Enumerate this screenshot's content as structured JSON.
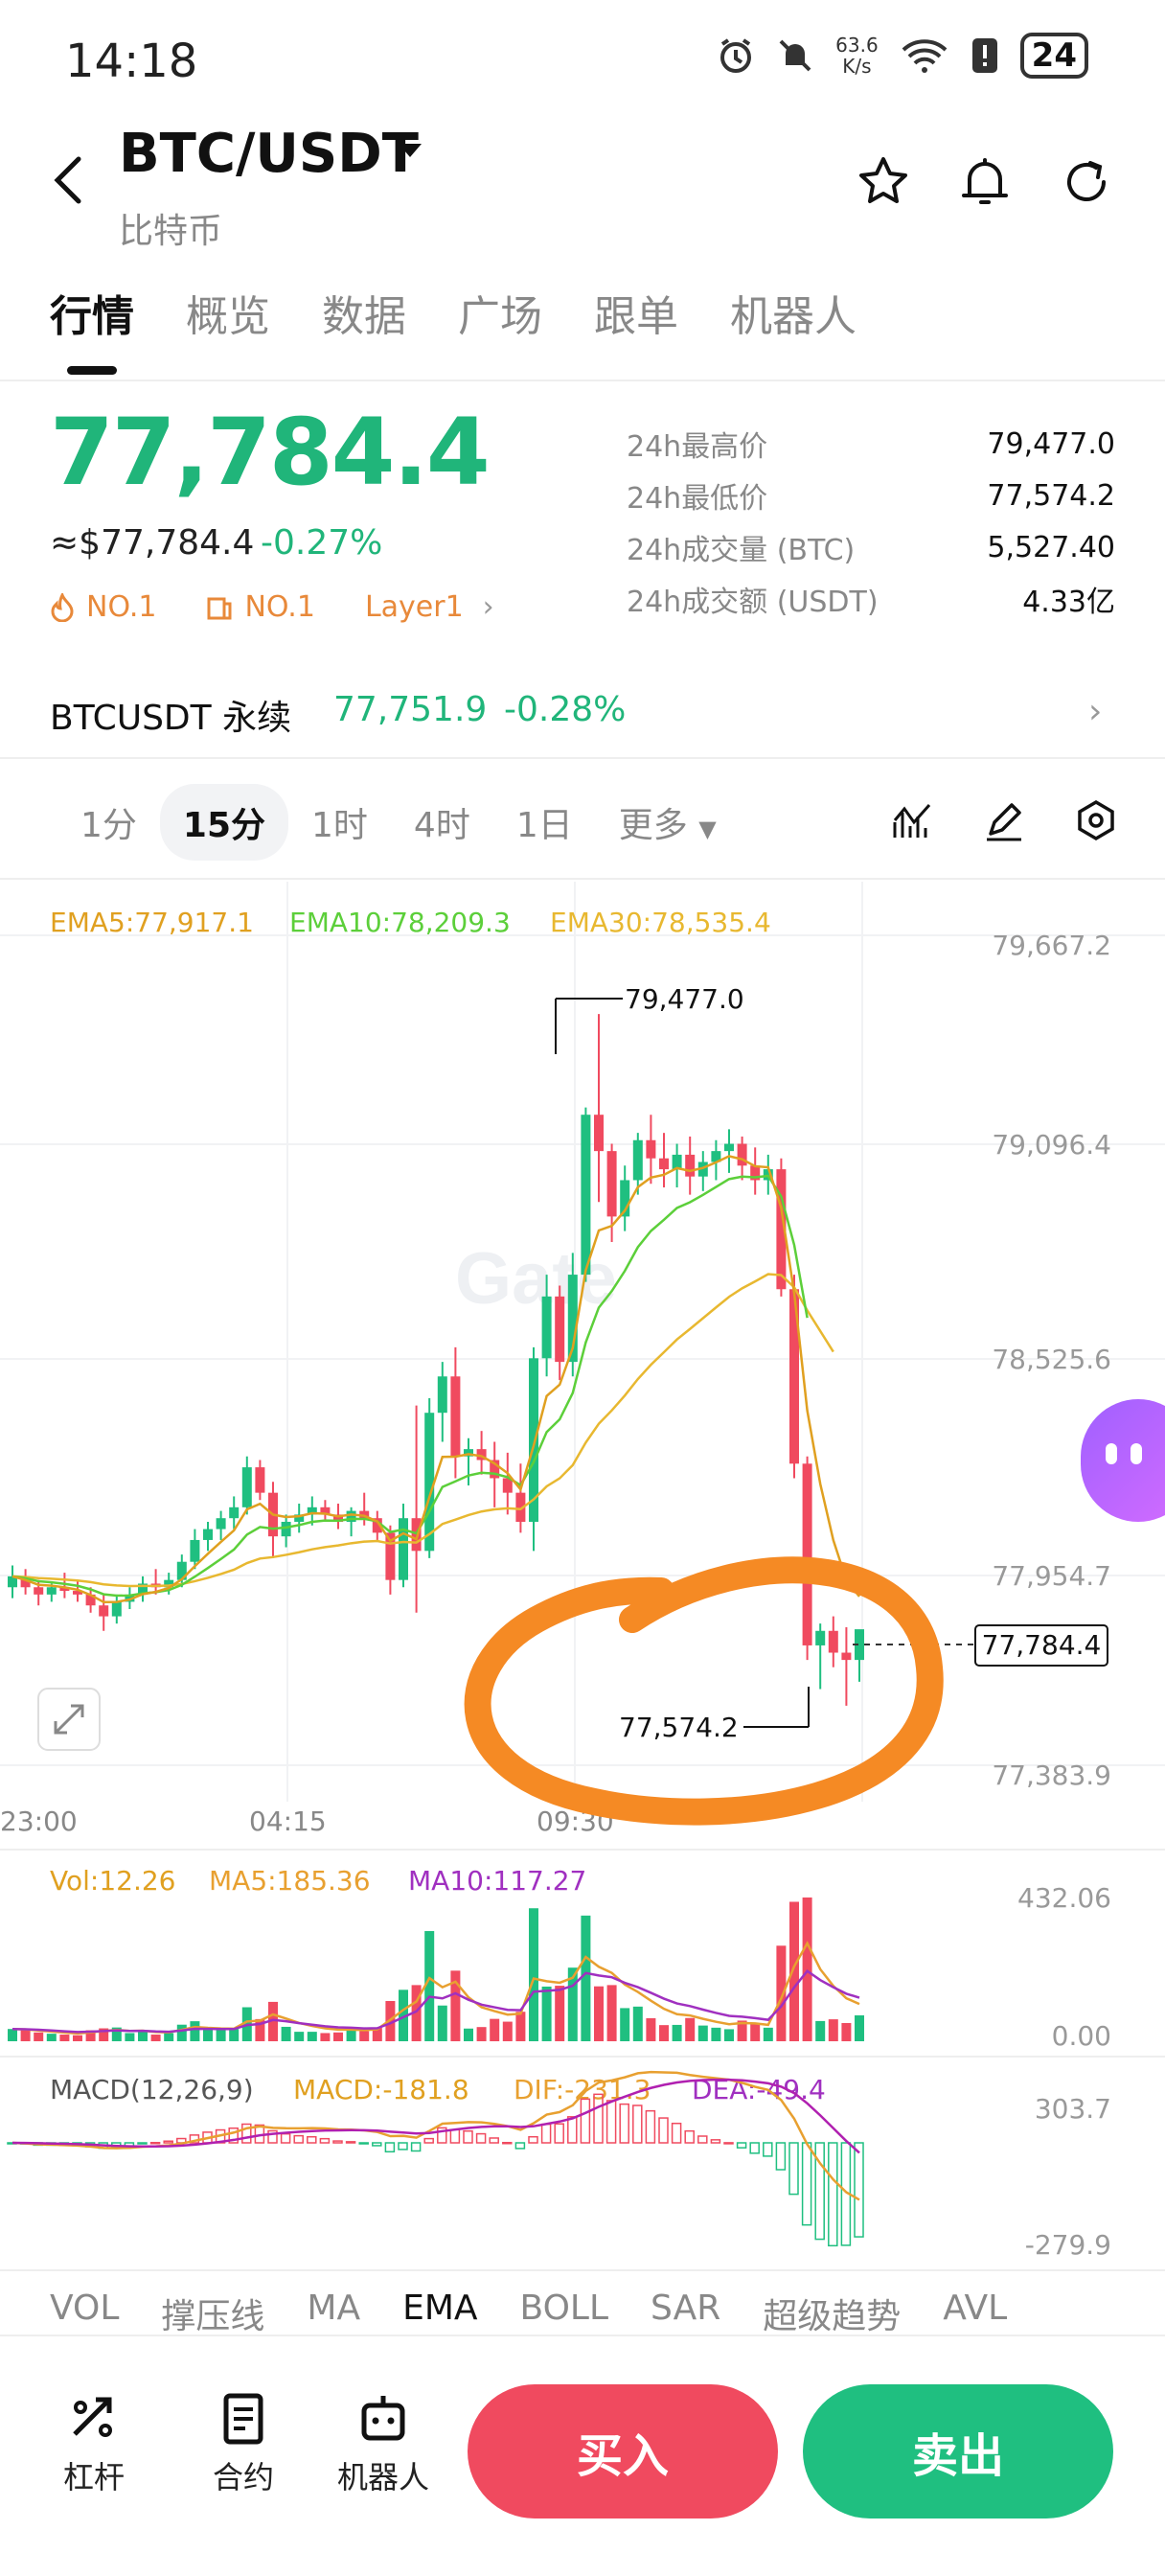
{
  "status": {
    "time": "14:18",
    "speed_top": "63.6",
    "speed_bottom": "K/s",
    "battery": "24"
  },
  "header": {
    "pair": "BTC/USDT",
    "subtitle": "比特币"
  },
  "tabs": [
    {
      "label": "行情",
      "active": true
    },
    {
      "label": "概览"
    },
    {
      "label": "数据"
    },
    {
      "label": "广场"
    },
    {
      "label": "跟单"
    },
    {
      "label": "机器人"
    }
  ],
  "ticker": {
    "price": "77,784.4",
    "usd": "≈$77,784.4",
    "change": "-0.27%",
    "badges": [
      "NO.1",
      "NO.1",
      "Layer1"
    ],
    "stats": [
      {
        "label": "24h最高价",
        "value": "79,477.0"
      },
      {
        "label": "24h最低价",
        "value": "77,574.2"
      },
      {
        "label": "24h成交量 (BTC)",
        "value": "5,527.40"
      },
      {
        "label": "24h成交额 (USDT)",
        "value": "4.33亿"
      }
    ]
  },
  "perp": {
    "label": "BTCUSDT 永续",
    "price": "77,751.9",
    "change": "-0.28%"
  },
  "timeframes": [
    {
      "label": "1分"
    },
    {
      "label": "15分",
      "active": true
    },
    {
      "label": "1时"
    },
    {
      "label": "4时"
    },
    {
      "label": "1日"
    },
    {
      "label": "更多"
    }
  ],
  "chart": {
    "ema_labels": {
      "ema5": "EMA5:77,917.1",
      "ema10": "EMA10:78,209.3",
      "ema30": "EMA30:78,535.4"
    },
    "y_ticks": [
      "79,667.2",
      "79,096.4",
      "78,525.6",
      "77,954.7",
      "77,383.9"
    ],
    "x_ticks": [
      "23:00",
      "04:15",
      "09:30"
    ],
    "high_label": "79,477.0",
    "low_label": "77,574.2",
    "current_label": "77,784.4",
    "vol_labels": {
      "vol": "Vol:12.26",
      "ma5": "MA5:185.36",
      "ma10": "MA10:117.27"
    },
    "vol_ticks": [
      "432.06",
      "0.00"
    ],
    "macd_labels": {
      "title": "MACD(12,26,9)",
      "macd": "MACD:-181.8",
      "dif": "DIF:-231.3",
      "dea": "DEA:-49.4"
    },
    "macd_ticks": [
      "303.7",
      "-279.9"
    ],
    "watermark": "Gate"
  },
  "chart_data": {
    "type": "candlestick",
    "interval": "15分",
    "ylim": [
      77383.9,
      79667.2
    ],
    "colors": {
      "up": "#1fbf80",
      "down": "#f04a5f",
      "ema5": "#e0a020",
      "ema10": "#5ccf3a",
      "ema30": "#e8b830"
    },
    "candles": [
      [
        77900,
        77960,
        77870,
        77930
      ],
      [
        77930,
        77950,
        77880,
        77900
      ],
      [
        77900,
        77920,
        77850,
        77880
      ],
      [
        77880,
        77910,
        77860,
        77900
      ],
      [
        77900,
        77940,
        77870,
        77890
      ],
      [
        77890,
        77920,
        77860,
        77880
      ],
      [
        77880,
        77900,
        77830,
        77850
      ],
      [
        77850,
        77880,
        77780,
        77820
      ],
      [
        77820,
        77880,
        77800,
        77860
      ],
      [
        77860,
        77900,
        77840,
        77880
      ],
      [
        77880,
        77930,
        77860,
        77910
      ],
      [
        77910,
        77950,
        77880,
        77900
      ],
      [
        77900,
        77940,
        77880,
        77920
      ],
      [
        77920,
        77990,
        77900,
        77970
      ],
      [
        77970,
        78060,
        77950,
        78030
      ],
      [
        78030,
        78080,
        78000,
        78060
      ],
      [
        78060,
        78110,
        78030,
        78090
      ],
      [
        78090,
        78150,
        78060,
        78120
      ],
      [
        78120,
        78260,
        78100,
        78230
      ],
      [
        78230,
        78250,
        78140,
        78160
      ],
      [
        78160,
        78190,
        77980,
        78040
      ],
      [
        78040,
        78100,
        78010,
        78080
      ],
      [
        78080,
        78130,
        78050,
        78100
      ],
      [
        78100,
        78150,
        78070,
        78120
      ],
      [
        78120,
        78140,
        78080,
        78100
      ],
      [
        78100,
        78130,
        78060,
        78080
      ],
      [
        78080,
        78120,
        78040,
        78110
      ],
      [
        78110,
        78160,
        78070,
        78090
      ],
      [
        78090,
        78110,
        78030,
        78050
      ],
      [
        78050,
        78070,
        77880,
        77920
      ],
      [
        77920,
        78130,
        77900,
        78090
      ],
      [
        78090,
        78400,
        77830,
        78000
      ],
      [
        78000,
        78420,
        77980,
        78380
      ],
      [
        78380,
        78520,
        78300,
        78480
      ],
      [
        78480,
        78560,
        78200,
        78260
      ],
      [
        78260,
        78310,
        78180,
        78280
      ],
      [
        78280,
        78330,
        78210,
        78250
      ],
      [
        78250,
        78300,
        78120,
        78200
      ],
      [
        78200,
        78270,
        78100,
        78160
      ],
      [
        78160,
        78240,
        78050,
        78080
      ],
      [
        78080,
        78560,
        78000,
        78530
      ],
      [
        78530,
        78760,
        78480,
        78700
      ],
      [
        78700,
        78730,
        78470,
        78520
      ],
      [
        78520,
        78820,
        78480,
        78760
      ],
      [
        78760,
        79220,
        78740,
        79200
      ],
      [
        79200,
        79477,
        78960,
        79100
      ],
      [
        79100,
        79120,
        78850,
        78920
      ],
      [
        78920,
        79060,
        78880,
        79020
      ],
      [
        79020,
        79150,
        78980,
        79130
      ],
      [
        79130,
        79200,
        79010,
        79080
      ],
      [
        79080,
        79150,
        79000,
        79050
      ],
      [
        79050,
        79120,
        79000,
        79090
      ],
      [
        79090,
        79140,
        78980,
        79030
      ],
      [
        79030,
        79100,
        78990,
        79070
      ],
      [
        79070,
        79130,
        79020,
        79100
      ],
      [
        79100,
        79160,
        79040,
        79120
      ],
      [
        79120,
        79140,
        79020,
        79060
      ],
      [
        79060,
        79110,
        78980,
        79020
      ],
      [
        79020,
        79090,
        78980,
        79050
      ],
      [
        79050,
        79080,
        78700,
        78720
      ],
      [
        78720,
        78760,
        78200,
        78240
      ],
      [
        78240,
        78260,
        77700,
        77740
      ],
      [
        77740,
        77800,
        77620,
        77780
      ],
      [
        77780,
        77820,
        77680,
        77720
      ],
      [
        77720,
        77790,
        77574.2,
        77700
      ],
      [
        77700,
        77760,
        77640,
        77784.4
      ]
    ]
  }
}
